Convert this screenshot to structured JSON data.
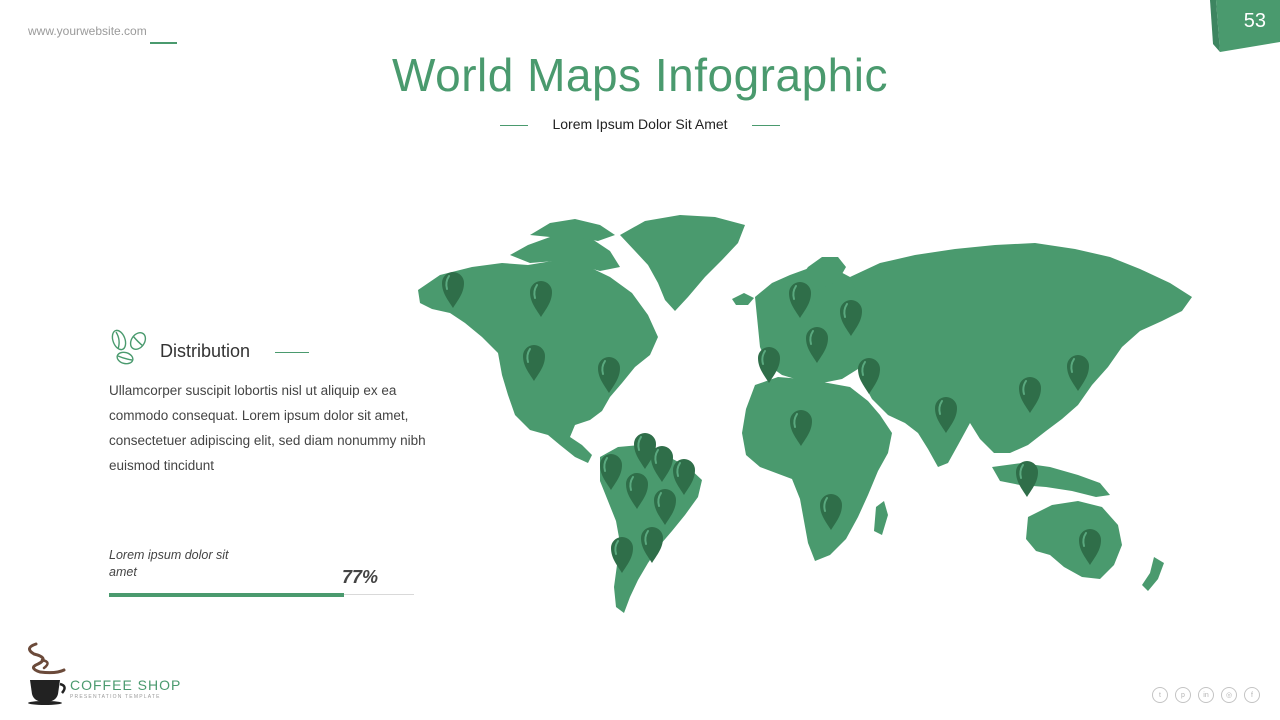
{
  "header": {
    "website": "www.yourwebsite.com",
    "page_number": "53"
  },
  "title": "World Maps Infographic",
  "subtitle": "Lorem Ipsum Dolor Sit Amet",
  "distribution": {
    "heading": "Distribution",
    "body": "Ullamcorper suscipit lobortis nisl ut aliquip ex ea commodo  consequat.  Lorem ipsum dolor sit amet, consectetuer adipiscing elit, sed diam nonummy nibh euismod tincidunt",
    "icon": "coffee-beans-icon"
  },
  "progress": {
    "label": "Lorem ipsum dolor sit amet",
    "value_text": "77%",
    "fraction": 0.77
  },
  "map": {
    "icon": "world-map",
    "pin_icon": "map-pin-icon",
    "pin_count": 25
  },
  "logo": {
    "name": "COFFEE SHOP",
    "tagline": "PRESENTATION TEMPLATE"
  },
  "socials": [
    {
      "name": "twitter-icon",
      "glyph": "t"
    },
    {
      "name": "pinterest-icon",
      "glyph": "p"
    },
    {
      "name": "linkedin-icon",
      "glyph": "in"
    },
    {
      "name": "instagram-icon",
      "glyph": "◎"
    },
    {
      "name": "facebook-icon",
      "glyph": "f"
    }
  ],
  "colors": {
    "accent": "#4a9a6e",
    "pin": "#2f6e49",
    "text": "#444444",
    "muted": "#9a9a9a"
  }
}
